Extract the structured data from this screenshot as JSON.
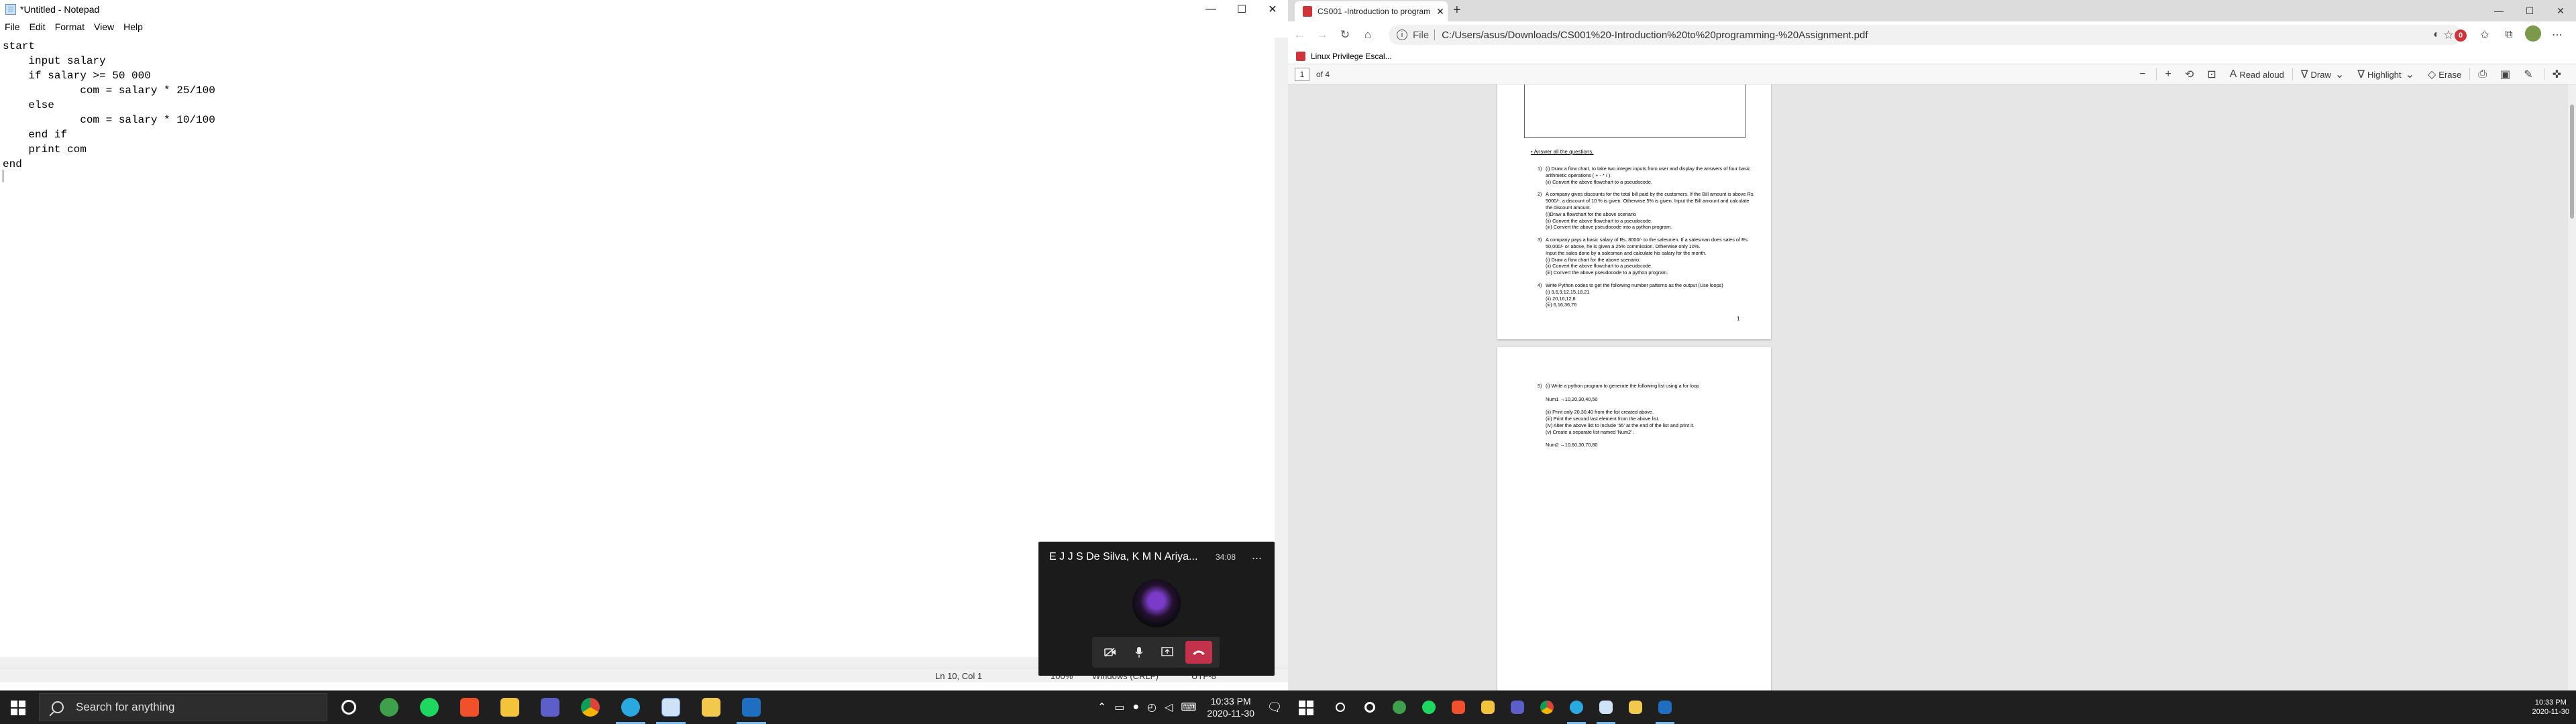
{
  "notepad": {
    "title": "*Untitled - Notepad",
    "menu": [
      "File",
      "Edit",
      "Format",
      "View",
      "Help"
    ],
    "content": "start\n    input salary\n    if salary >= 50 000\n            com = salary * 25/100\n    else\n            com = salary * 10/100\n    end if\n    print com\nend",
    "status": {
      "position": "Ln 10, Col 1",
      "zoom": "100%",
      "eol": "Windows (CRLF)",
      "encoding": "UTF-8"
    }
  },
  "window_controls": {
    "minimize": "—",
    "maximize": "☐",
    "close": "✕"
  },
  "zoom_call": {
    "participants": "E J J S De Silva, K M N Ariya...",
    "time": "34:08",
    "more": "..."
  },
  "taskbar_left": {
    "search_placeholder": "Search for anything",
    "time": "10:33 PM",
    "date": "2020-11-30",
    "notification_count": "3"
  },
  "edge": {
    "tab_title": "CS001 -Introduction to program",
    "url_scheme": "File",
    "url": "C:/Users/asus/Downloads/CS001%20-Introduction%20to%20programming-%20Assignment.pdf",
    "favorite": "Linux Privilege Escal...",
    "page_current": "1",
    "page_total": "of 4",
    "tools": {
      "read_aloud": "Read aloud",
      "draw": "Draw",
      "highlight": "Highlight",
      "erase": "Erase"
    }
  },
  "pdf": {
    "heading": "Answer all the questions.",
    "page_number": "1",
    "page1_questions": [
      {
        "n": "1)",
        "lines": [
          "(i) Draw a flow chart, to take two integer inputs from user and display the answers of four basic",
          "     arithmetic operations ( + - * / ).",
          "(ii) Convert the above flowchart to a pseudocode."
        ]
      },
      {
        "n": "2)",
        "lines": [
          "A company gives discounts for the total bill paid by the customers. If the Bill amount is above Rs.",
          "5000/-, a discount of 10 % is given. Otherwise 5% is given. Input the Bill amount and calculate",
          "the discount amount.",
          "(i)Draw a flowchart for the above scenario",
          "(ii) Convert the above flowchart to a pseudocode.",
          "(iii) Convert the above pseudocode into a python program."
        ]
      },
      {
        "n": "3)",
        "lines": [
          "A company pays a basic salary of Rs. 8000/- to the salesmen. If a salesman does sales of Rs.",
          "50,000/- or above, he is given a 25% commission. Otherwise only 10%.",
          "Input the sales done by a salesman and calculate his salary for the month.",
          "(i) Draw a flow chart for the above scenario.",
          "(ii) Convert the above flowchart to a pseudocode.",
          "(iii) Convert the above pseudocode to a python program."
        ]
      },
      {
        "n": "4)",
        "lines": [
          "Write Python codes to get the following number patterns as the output (Use loops)",
          "(i) 3,6,9,12,15,18,21",
          "(ii) 20,16,12,8",
          "(iii) 6,16,36,76"
        ]
      }
    ],
    "page2_questions": [
      {
        "n": "5)",
        "lines": [
          "(i) Write a python program to generate the following list using a for loop",
          "",
          "          Num1 →10,20,30,40,50",
          "",
          "(ii)  Print only 20,30,40 from the list created above.",
          "(iii) Print the second last element from the above list.",
          "(iv) Alter the above list to include '55' at the end of the list and print it.",
          "(v) Create a separate list named 'Num2' .",
          "",
          "          Num2 →10,60,30,70,80"
        ]
      }
    ]
  },
  "taskbar_right": {
    "time": "10:33 PM",
    "date": "2020-11-30"
  }
}
